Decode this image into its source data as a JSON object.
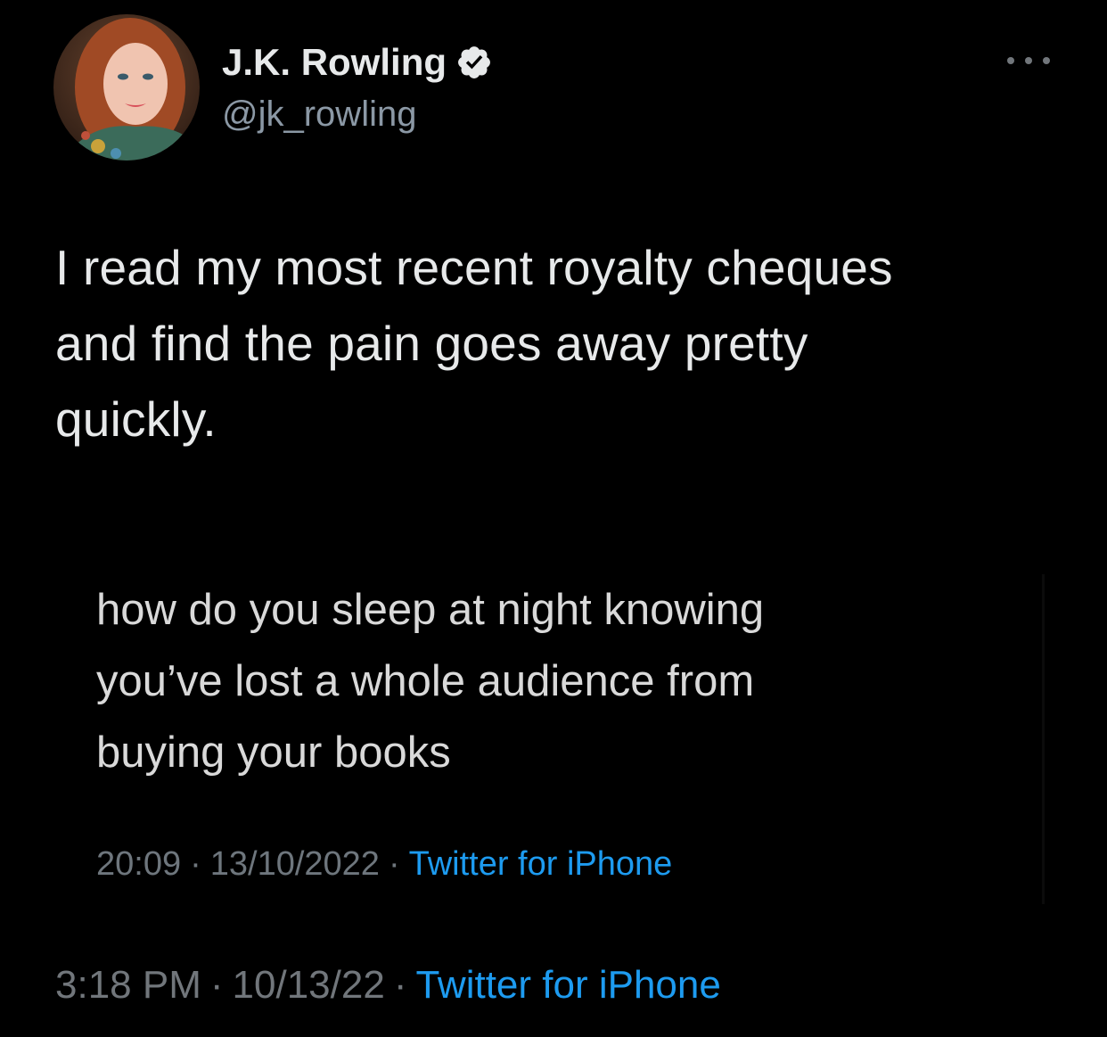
{
  "author": {
    "name": "J.K. Rowling",
    "handle": "@jk_rowling",
    "verified": true,
    "verified_color": "#e7e9ea"
  },
  "tweet": {
    "text": "I read my most recent royalty cheques\nand find the pain goes away pretty\nquickly."
  },
  "embedded_image": {
    "text": "how do you sleep at night knowing\nyou’ve lost a whole audience from\nbuying your books",
    "time": "20:09",
    "separator": "·",
    "date": "13/10/2022",
    "source": "Twitter for iPhone"
  },
  "meta": {
    "time": "3:18 PM",
    "separator": "·",
    "date": "10/13/22",
    "source": "Twitter for iPhone"
  },
  "colors": {
    "background": "#000000",
    "text_primary": "#e7e9ea",
    "text_secondary": "#71767b",
    "link": "#1d9bf0"
  },
  "icons": {
    "verified": "verified-badge-icon",
    "more": "more-dots-icon"
  }
}
